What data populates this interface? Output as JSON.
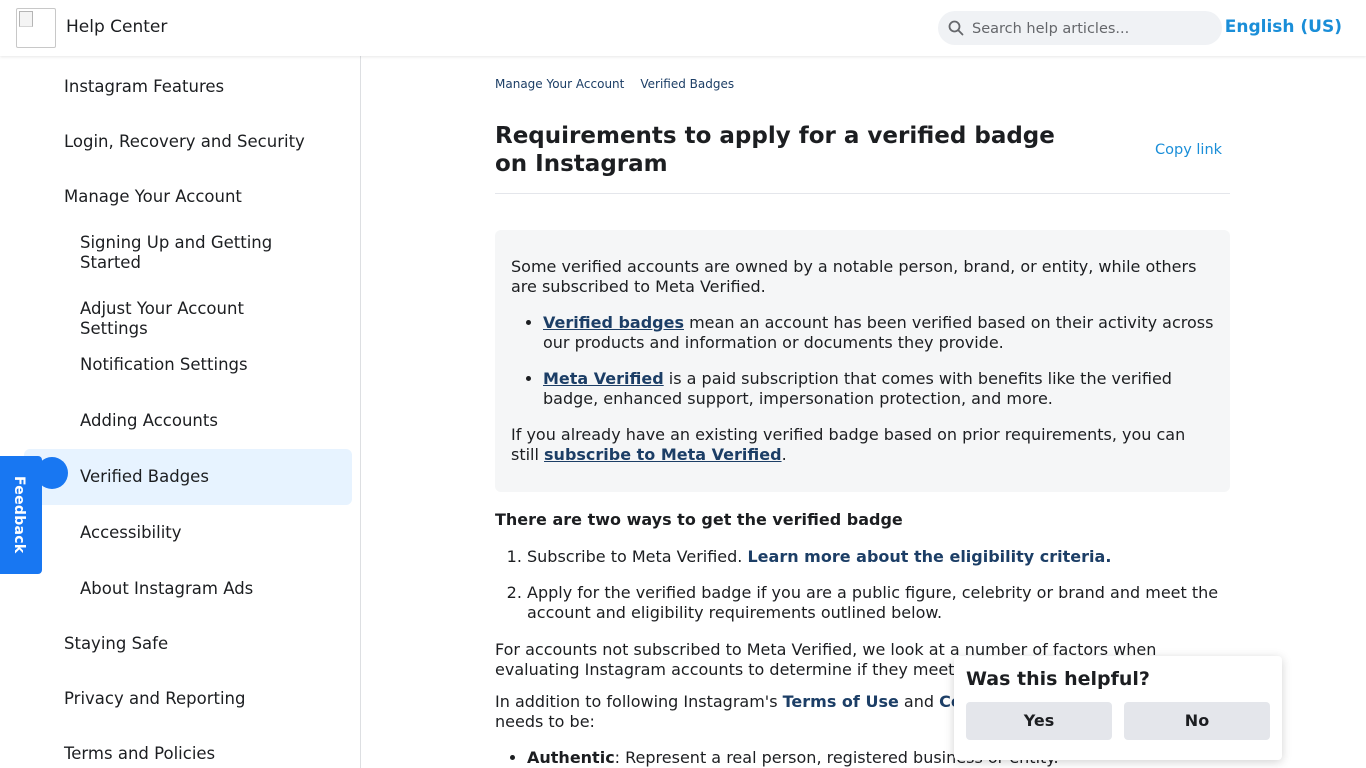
{
  "header": {
    "brand": "Help Center",
    "search_placeholder": "Search help articles...",
    "language": "English (US)"
  },
  "sidebar": {
    "items": [
      {
        "label": "Instagram Features"
      },
      {
        "label": "Login, Recovery and Security"
      },
      {
        "label": "Manage Your Account"
      },
      {
        "label": "Signing Up and Getting Started"
      },
      {
        "label": "Adjust Your Account Settings"
      },
      {
        "label": "Notification Settings"
      },
      {
        "label": "Adding Accounts"
      },
      {
        "label": "Verified Badges"
      },
      {
        "label": "Accessibility"
      },
      {
        "label": "About Instagram Ads"
      },
      {
        "label": "Staying Safe"
      },
      {
        "label": "Privacy and Reporting"
      },
      {
        "label": "Terms and Policies"
      }
    ],
    "feedback": "Feedback"
  },
  "breadcrumb": [
    "Manage Your Account",
    "Verified Badges"
  ],
  "article": {
    "title": "Requirements to apply for a verified badge on Instagram",
    "copy_link": "Copy link",
    "intro": "Some verified accounts are owned by a notable person, brand, or entity, while others are subscribed to Meta Verified.",
    "bullets": [
      {
        "link": "Verified badges",
        "text": " mean an account has been verified based on their activity across our products and information or documents they provide."
      },
      {
        "link": "Meta Verified",
        "text": " is a paid subscription that comes with benefits like the verified badge, enhanced support, impersonation protection, and more."
      }
    ],
    "existing_prefix": "If you already have an existing verified badge based on prior requirements, you can still ",
    "existing_link": "subscribe to Meta Verified",
    "existing_suffix": ".",
    "ways_title": "There are two ways to get the verified badge",
    "ways": [
      {
        "text": "Subscribe to Meta Verified. ",
        "link": "Learn more about the eligibility criteria."
      },
      {
        "text": "Apply for the verified badge if you are a public figure, celebrity or brand and meet the account and eligibility requirements outlined below.",
        "link": ""
      }
    ],
    "factors": "For accounts not subscribed to Meta Verified, we look at a number of factors when evaluating Instagram accounts to determine if they meet our verification",
    "following_prefix": "In addition to following Instagram's ",
    "terms_link": "Terms of Use",
    "and": " and ",
    "community_link": "Comm",
    "needs": "needs to be:",
    "authentic_label": "Authentic",
    "authentic_text": ": Represent a real person, registered business or entity."
  },
  "helpful": {
    "question": "Was this helpful?",
    "yes": "Yes",
    "no": "No"
  }
}
